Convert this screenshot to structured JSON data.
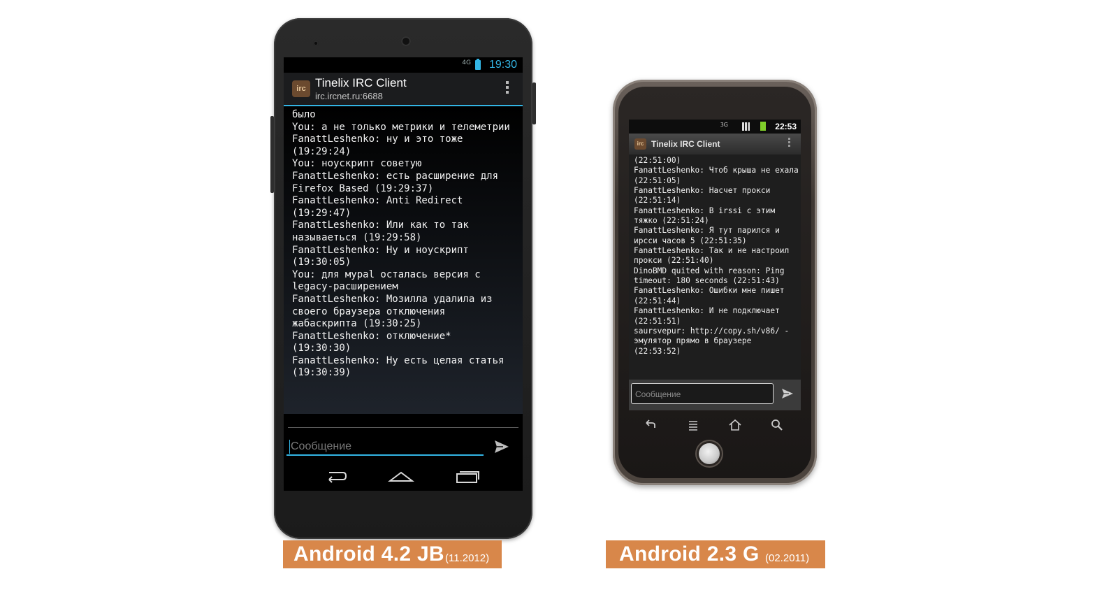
{
  "left_device": {
    "status_bar": {
      "network": "4G",
      "time": "19:30"
    },
    "action_bar": {
      "app_title": "Tinelix IRC Client",
      "server": "irc.ircnet.ru:6688",
      "app_icon_text": "irc"
    },
    "messages": [
      "было",
      "You: а не только метрики и телеметрии",
      "FanattLeshenko: ну и это тоже (19:29:24)",
      "You: ноускрипт советую",
      "FanattLeshenko: есть расширение для Firefox Based (19:29:37)",
      "FanattLeshenko: Anti Redirect (19:29:47)",
      "FanattLeshenko: Или как то так называеться (19:29:58)",
      "FanattLeshenko: Ну и ноускрипт (19:30:05)",
      "You: для мурal осталась версия с legacy-расширением",
      "FanattLeshenko: Мозилла удалила из своего браузера отключения жабаскрипта (19:30:25)",
      "FanattLeshenko: отключение* (19:30:30)",
      "FanattLeshenko: Ну есть целая статья (19:30:39)"
    ],
    "input": {
      "placeholder": "Сообщение"
    },
    "icons": [
      "back-icon",
      "home-icon",
      "recents-icon",
      "send-icon",
      "overflow-menu-icon"
    ]
  },
  "right_device": {
    "status_bar": {
      "network": "3G",
      "time": "22:53"
    },
    "title_bar": {
      "app_title": "Tinelix IRC Client",
      "app_icon_text": "irc"
    },
    "messages": [
      "(22:51:00)",
      "FanattLeshenko: Чтоб крыша не ехала (22:51:05)",
      "FanattLeshenko: Насчет прокси (22:51:14)",
      "FanattLeshenko: В irssi с этим тяжко (22:51:24)",
      "FanattLeshenko: Я тут парился и ирсси часов 5 (22:51:35)",
      "FanattLeshenko: Так и не настроил прокси (22:51:40)",
      "DinoBMD quited with reason: Ping timeout: 180 seconds (22:51:43)",
      "FanattLeshenko: Ошибки мне пишет (22:51:44)",
      "FanattLeshenko: И не подключает (22:51:51)",
      "saursvepur: http://copy.sh/v86/ - эмулятор прямо в браузере (22:53:52)"
    ],
    "input": {
      "placeholder": "Сообщение"
    },
    "icons": [
      "back-icon",
      "menu-icon",
      "home-icon",
      "search-icon",
      "send-icon",
      "overflow-menu-icon"
    ]
  },
  "captions": {
    "left": {
      "name": "Android 4.2 JB",
      "date": "(11.2012)"
    },
    "right": {
      "name": "Android 2.3 G",
      "date": "(02.2011)"
    }
  },
  "colors": {
    "holo_blue": "#33b5e5",
    "caption_bg": "#d8874a",
    "gb_battery": "#7fce2a"
  }
}
